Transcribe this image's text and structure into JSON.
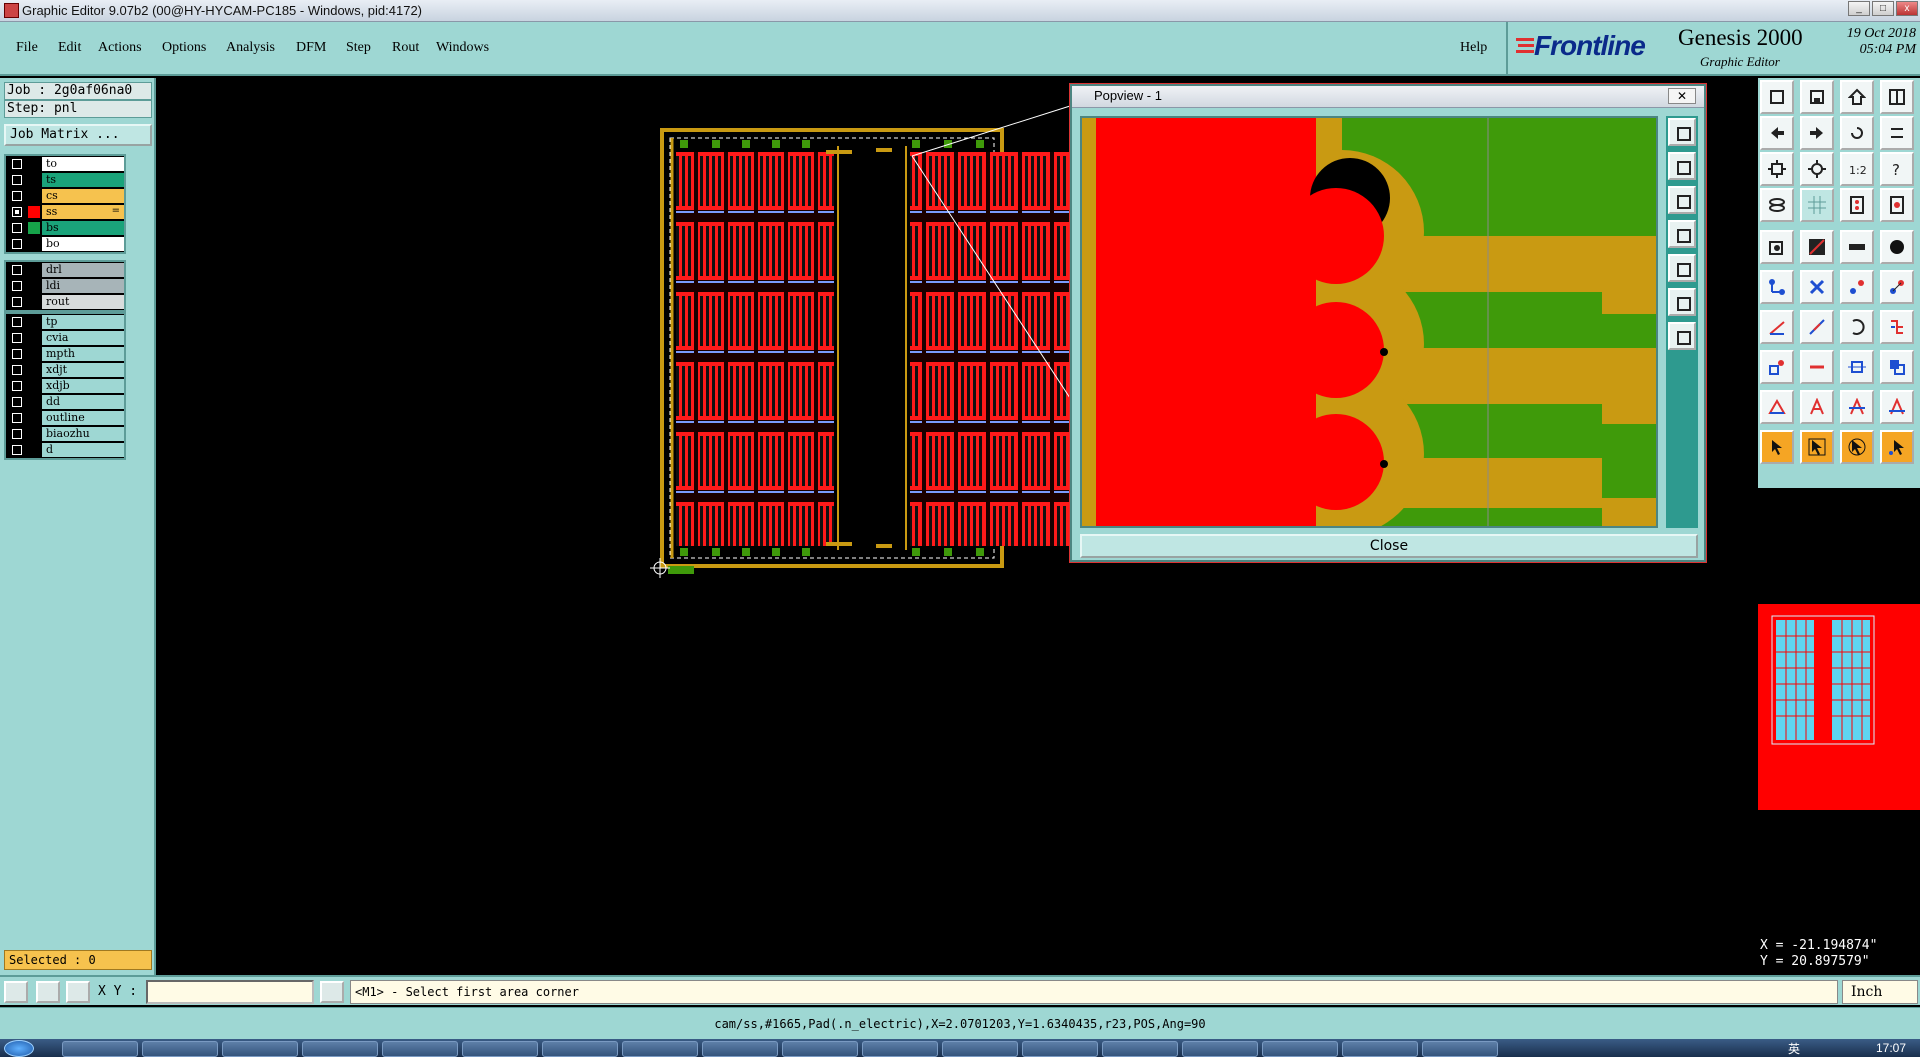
{
  "window": {
    "title": "Graphic Editor 9.07b2 (00@HY-HYCAM-PC185 - Windows, pid:4172)"
  },
  "menu": {
    "items": [
      "File",
      "Edit",
      "Actions",
      "Options",
      "Analysis",
      "DFM",
      "Step",
      "Rout",
      "Windows"
    ],
    "help": "Help"
  },
  "brand": {
    "logo": "Frontline",
    "product": "Genesis 2000",
    "subtitle": "Graphic Editor",
    "date": "19 Oct 2018",
    "time": "05:04 PM"
  },
  "job": {
    "job_line": "Job : 2g0af06na0",
    "step_line": "Step: pnl",
    "matrix_button": "Job Matrix ..."
  },
  "layers": {
    "group1": [
      {
        "name": "to",
        "color": "#ffffff",
        "swatch": "#000000",
        "checked": false
      },
      {
        "name": "ts",
        "color": "#1aa37a",
        "swatch": "#000000",
        "checked": false
      },
      {
        "name": "cs",
        "color": "#f6c24e",
        "swatch": "#000000",
        "checked": false
      },
      {
        "name": "ss",
        "color": "#f6c24e",
        "swatch": "#ff0000",
        "checked": true
      },
      {
        "name": "bs",
        "color": "#1aa37a",
        "swatch": "#16a34a",
        "checked": false
      },
      {
        "name": "bo",
        "color": "#ffffff",
        "swatch": "#000000",
        "checked": false
      }
    ],
    "group2": [
      {
        "name": "drl",
        "color": "#a7b4b8",
        "swatch": "#000000",
        "checked": false
      },
      {
        "name": "ldi",
        "color": "#a7b4b8",
        "swatch": "#000000",
        "checked": false
      },
      {
        "name": "rout",
        "color": "#d8dcdc",
        "swatch": "#000000",
        "checked": false
      }
    ],
    "group3": [
      {
        "name": "tp",
        "color": "#9ed7d3",
        "swatch": "#000000",
        "checked": false
      },
      {
        "name": "cvia",
        "color": "#9ed7d3",
        "swatch": "#000000",
        "checked": false
      },
      {
        "name": "mpth",
        "color": "#9ed7d3",
        "swatch": "#000000",
        "checked": false
      },
      {
        "name": "xdjt",
        "color": "#9ed7d3",
        "swatch": "#000000",
        "checked": false
      },
      {
        "name": "xdjb",
        "color": "#9ed7d3",
        "swatch": "#000000",
        "checked": false
      },
      {
        "name": "dd",
        "color": "#9ed7d3",
        "swatch": "#000000",
        "checked": false
      },
      {
        "name": "outline",
        "color": "#9ed7d3",
        "swatch": "#000000",
        "checked": false
      },
      {
        "name": "biaozhu",
        "color": "#9ed7d3",
        "swatch": "#000000",
        "checked": false
      },
      {
        "name": "d",
        "color": "#9ed7d3",
        "swatch": "#000000",
        "checked": false
      }
    ],
    "active_marker": "="
  },
  "selection": {
    "selected": "Selected : 0"
  },
  "popview": {
    "title": "Popview - 1",
    "close_glyph": "✕",
    "close_label": "Close"
  },
  "command": {
    "xy_label": "X Y :",
    "xy_value": "",
    "prompt": "<M1> - Select first area corner",
    "units": "Inch"
  },
  "coords": {
    "x": "X = -21.194874\"",
    "y": "Y = 20.897579\""
  },
  "status": {
    "text": "cam/ss,#1665,Pad(.n_electric),X=2.0701203,Y=1.6340435,r23,POS,Ang=90"
  },
  "taskbar": {
    "clock": "17:07",
    "ime": "英"
  },
  "colors": {
    "panel": "#9ed7d3",
    "copper": "#c99a12",
    "mask": "#ff0000",
    "green": "#3f9a0a"
  }
}
